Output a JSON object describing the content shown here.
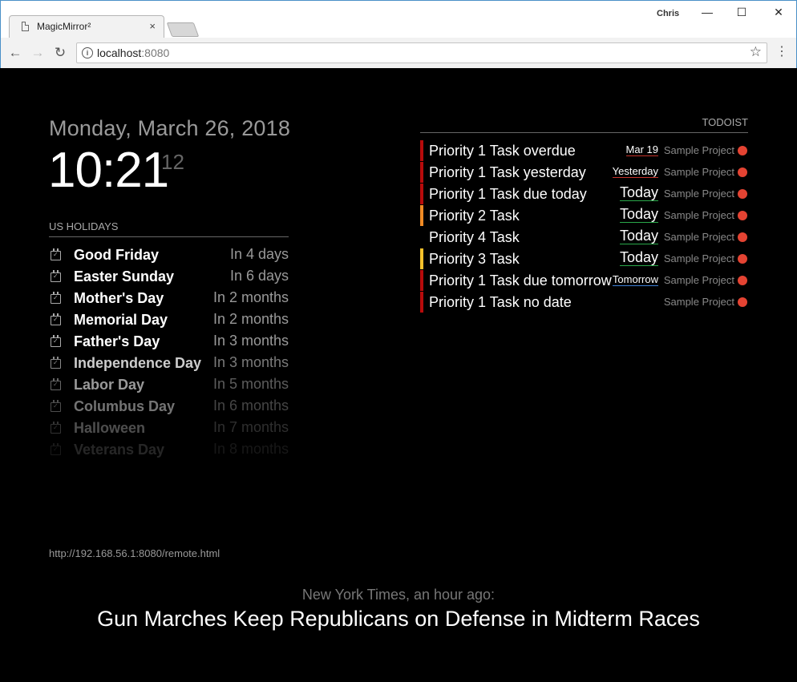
{
  "browser": {
    "tab_title": "MagicMirror²",
    "tab_close": "×",
    "profile_name": "Chris",
    "min_glyph": "—",
    "max_glyph": "☐",
    "close_glyph": "✕",
    "back_glyph": "←",
    "forward_glyph": "→",
    "reload_glyph": "↻",
    "info_glyph": "i",
    "url_host": "localhost",
    "url_port": ":8080",
    "star_glyph": "☆",
    "menu_glyph": "⋮"
  },
  "clock": {
    "date": "Monday, March 26, 2018",
    "time": "10:21",
    "seconds": "12"
  },
  "calendar": {
    "header": "US HOLIDAYS",
    "events": [
      {
        "title": "Good Friday",
        "when": "In 4 days",
        "opacity": 1.0
      },
      {
        "title": "Easter Sunday",
        "when": "In 6 days",
        "opacity": 1.0
      },
      {
        "title": "Mother's Day",
        "when": "In 2 months",
        "opacity": 1.0
      },
      {
        "title": "Memorial Day",
        "when": "In 2 months",
        "opacity": 1.0
      },
      {
        "title": "Father's Day",
        "when": "In 3 months",
        "opacity": 1.0
      },
      {
        "title": "Independence Day",
        "when": "In 3 months",
        "opacity": 0.8
      },
      {
        "title": "Labor Day",
        "when": "In 5 months",
        "opacity": 0.6
      },
      {
        "title": "Columbus Day",
        "when": "In 6 months",
        "opacity": 0.45
      },
      {
        "title": "Halloween",
        "when": "In 7 months",
        "opacity": 0.3
      },
      {
        "title": "Veterans Day",
        "when": "In 8 months",
        "opacity": 0.15
      }
    ]
  },
  "todoist": {
    "header": "TODOIST",
    "tasks": [
      {
        "title": "Priority 1 Task overdue",
        "due": "Mar 19",
        "due_type": "overdue",
        "project": "Sample Project",
        "priority_color": "#b80b0b"
      },
      {
        "title": "Priority 1 Task yesterday",
        "due": "Yesterday",
        "due_type": "overdue",
        "project": "Sample Project",
        "priority_color": "#b80b0b"
      },
      {
        "title": "Priority 1 Task due today",
        "due": "Today",
        "due_type": "today",
        "project": "Sample Project",
        "priority_color": "#b80b0b"
      },
      {
        "title": "Priority 2 Task",
        "due": "Today",
        "due_type": "today",
        "project": "Sample Project",
        "priority_color": "#f08a24"
      },
      {
        "title": "Priority 4 Task",
        "due": "Today",
        "due_type": "today",
        "project": "Sample Project",
        "priority_color": ""
      },
      {
        "title": "Priority 3 Task",
        "due": "Today",
        "due_type": "today",
        "project": "Sample Project",
        "priority_color": "#f6c12b"
      },
      {
        "title": "Priority 1 Task due tomorrow",
        "due": "Tomorrow",
        "due_type": "tomorrow",
        "project": "Sample Project",
        "priority_color": "#b80b0b"
      },
      {
        "title": "Priority 1 Task no date",
        "due": "",
        "due_type": "none",
        "project": "Sample Project",
        "priority_color": "#b80b0b"
      }
    ],
    "project_color": "#e44332"
  },
  "remote": {
    "url": "http://192.168.56.1:8080/remote.html"
  },
  "news": {
    "source": "New York Times, an hour ago:",
    "headline": "Gun Marches Keep Republicans on Defense in Midterm Races"
  }
}
